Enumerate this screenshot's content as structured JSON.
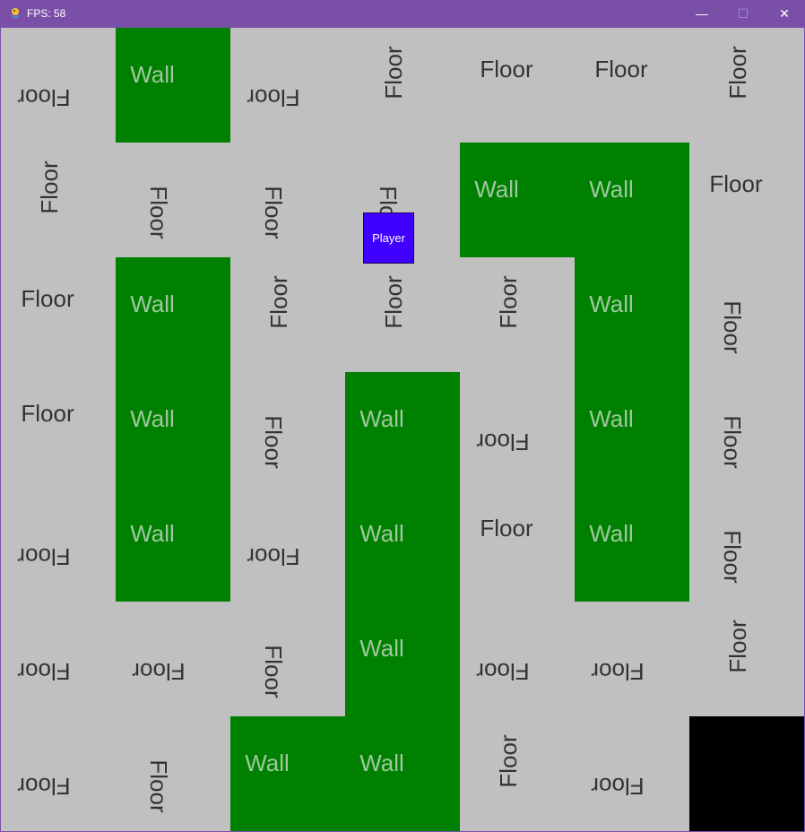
{
  "window": {
    "title": "FPS: 58",
    "minimize": "—",
    "maximize": "☐",
    "close": "✕"
  },
  "labels": {
    "floor": "Floor",
    "wall": "Wall",
    "player": "Player"
  },
  "grid": {
    "rows": 7,
    "cols": 7,
    "legend": {
      "F": "floor",
      "W": "wall",
      "B": "empty"
    },
    "cells": [
      "FWFFFFF",
      "FFFFWWF",
      "FWFFFWF",
      "FWFWFWF",
      "FWFWFWF",
      "FFFWFFF",
      "FFWWFFB"
    ],
    "label_orientation": [
      [
        "flip",
        "up",
        "flip",
        "ccw",
        "up",
        "up",
        "ccw"
      ],
      [
        "ccw",
        "cw",
        "cw",
        "cw",
        "up",
        "up",
        "up"
      ],
      [
        "up",
        "up",
        "ccw",
        "ccw",
        "ccw",
        "up",
        "cw"
      ],
      [
        "up",
        "up",
        "cw",
        "up",
        "flip",
        "up",
        "cw"
      ],
      [
        "flip",
        "up",
        "flip",
        "up",
        "up",
        "up",
        "cw"
      ],
      [
        "flip",
        "flip",
        "cw",
        "up",
        "flip",
        "flip",
        "ccw"
      ],
      [
        "flip",
        "cw",
        "up",
        "up",
        "ccw",
        "flip",
        ""
      ]
    ]
  },
  "player_cell": {
    "row": 1,
    "col": 3
  }
}
